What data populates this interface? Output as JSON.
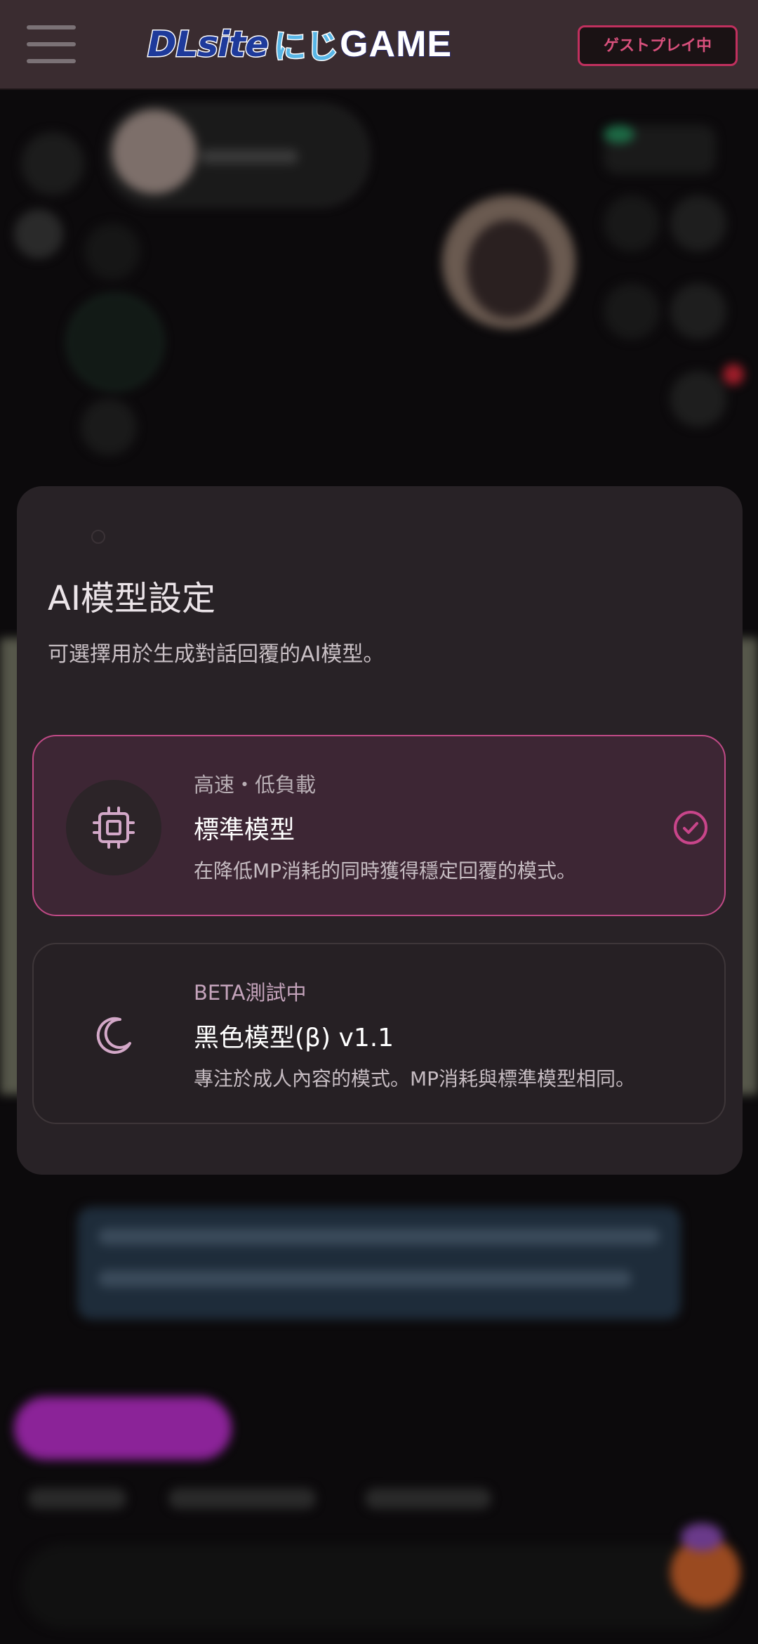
{
  "header": {
    "logo_dl": "DLsite",
    "logo_niji": "にじ",
    "logo_game": "GAME",
    "guest_button": "ゲストプレイ中"
  },
  "modal": {
    "title": "AI模型設定",
    "description": "可選擇用於生成對話回覆的AI模型。",
    "options": [
      {
        "tag": "高速・低負載",
        "name": "標準模型",
        "description": "在降低MP消耗的同時獲得穩定回覆的模式。",
        "icon": "chip-icon",
        "selected": true
      },
      {
        "tag": "BETA測試中",
        "name": "黑色模型(β) v1.1",
        "description": "專注於成人內容的模式。MP消耗與標準模型相同。",
        "icon": "moon-icon",
        "selected": false
      }
    ]
  },
  "colors": {
    "accent": "#c04a86",
    "header_bg": "#3a2c30",
    "modal_bg": "#282226",
    "selected_bg": "#3d2634"
  }
}
